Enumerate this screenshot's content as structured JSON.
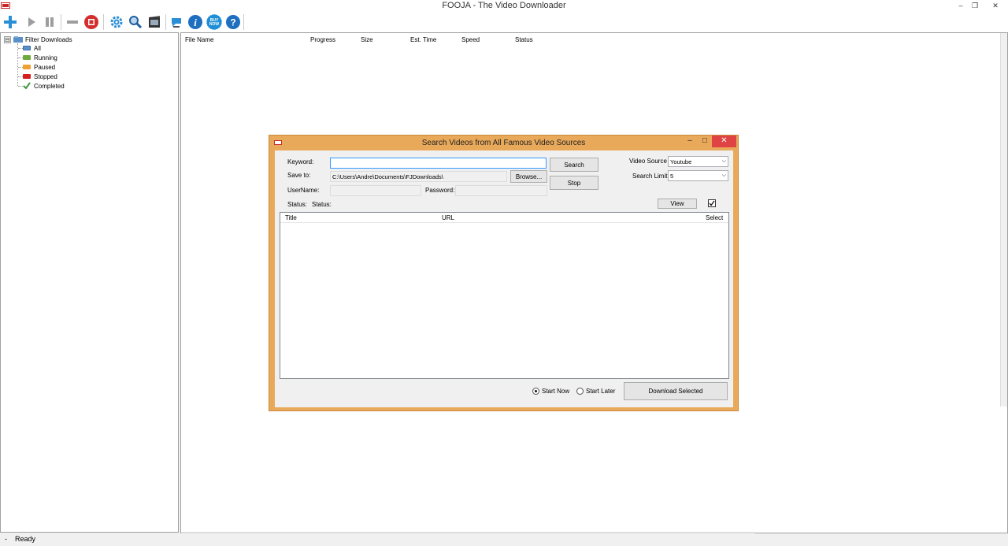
{
  "window": {
    "title": "FOOJA - The Video Downloader",
    "minimize_glyph": "–",
    "restore_glyph": "❐",
    "close_glyph": "✕"
  },
  "toolbar": {
    "buttons": [
      {
        "name": "add-download-button",
        "icon": "plus-icon",
        "color": "#2b8fd6"
      },
      {
        "name": "resume-button",
        "icon": "play-icon",
        "color": "#9e9e9e"
      },
      {
        "name": "pause-button",
        "icon": "pause-icon",
        "color": "#9e9e9e"
      },
      {
        "name": "remove-button",
        "icon": "minus-icon",
        "color": "#9e9e9e"
      },
      {
        "name": "stop-button",
        "icon": "stop-icon",
        "color": "#d32f2f"
      },
      {
        "name": "settings-button",
        "icon": "gear-icon",
        "color": "#2b8fd6"
      },
      {
        "name": "search-button",
        "icon": "magnifier-icon",
        "color": "#1e5fa0"
      },
      {
        "name": "video-button",
        "icon": "film-icon",
        "color": "#333333"
      },
      {
        "name": "feedback-button",
        "icon": "chat-icon",
        "color": "#2b8fd6"
      },
      {
        "name": "about-button",
        "icon": "info-icon",
        "color": "#1e6fc0"
      },
      {
        "name": "buy-now-button",
        "icon": "buy-now-badge-icon",
        "color": "#1e8fd6",
        "text": "BUY NOW"
      },
      {
        "name": "help-button",
        "icon": "help-icon",
        "color": "#1e6fc0"
      }
    ]
  },
  "tree": {
    "root_label": "Filter Downloads",
    "expander": "⊟",
    "items": [
      {
        "label": "All",
        "color": "#5b8fc7"
      },
      {
        "label": "Running",
        "color": "#6dab3c"
      },
      {
        "label": "Paused",
        "color": "#f0a030"
      },
      {
        "label": "Stopped",
        "color": "#d42020"
      },
      {
        "label": "Completed",
        "color": "#3a9a3a"
      }
    ]
  },
  "downloads_list": {
    "columns": [
      "File Name",
      "Progress",
      "Size",
      "Est. Time",
      "Speed",
      "Status"
    ]
  },
  "statusbar": {
    "grip": "-",
    "text": "Ready"
  },
  "search_dialog": {
    "title": "Search Videos from All Famous Video Sources",
    "minimize_glyph": "–",
    "maximize_glyph": "□",
    "close_glyph": "✕",
    "keyword_label": "Keyword:",
    "keyword_value": "",
    "save_to_label": "Save to:",
    "save_to_value": "C:\\Users\\Andre\\Documents\\FJDownloads\\",
    "browse_label": "Browse...",
    "username_label": "UserName:",
    "password_label": "Password:",
    "search_label": "Search",
    "stop_label": "Stop",
    "video_source_label": "Video Source",
    "video_source_value": "Youtube",
    "search_limit_label": "Search Limit",
    "search_limit_value": "5",
    "status_label": "Status:",
    "status_value": "Status:",
    "view_label": "View",
    "view_checked": true,
    "results_columns": [
      "Title",
      "URL",
      "Select"
    ],
    "start_now_label": "Start Now",
    "start_later_label": "Start Later",
    "start_mode": "Start Now",
    "download_selected_label": "Download Selected"
  }
}
